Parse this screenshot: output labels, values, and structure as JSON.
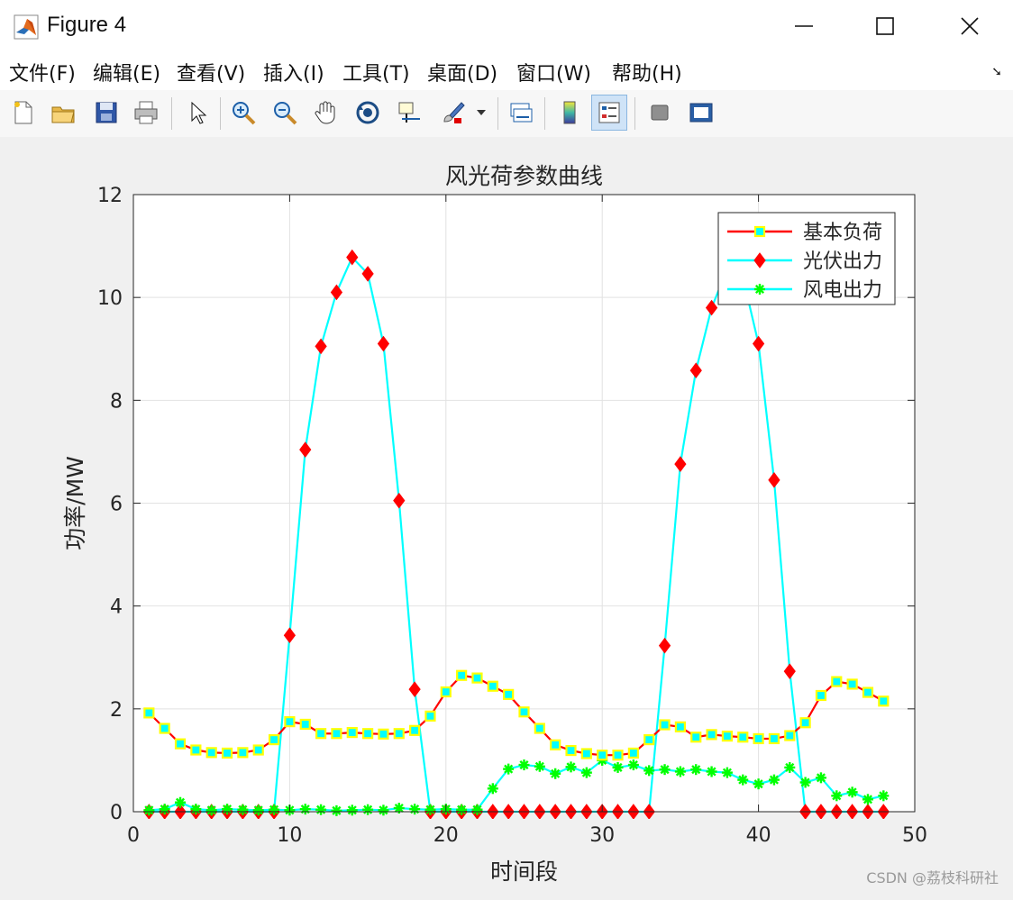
{
  "window": {
    "title": "Figure 4"
  },
  "menu": [
    "文件(F)",
    "编辑(E)",
    "查看(V)",
    "插入(I)",
    "工具(T)",
    "桌面(D)",
    "窗口(W)",
    "帮助(H)"
  ],
  "toolbar": {
    "icons": [
      "new-file-icon",
      "open-folder-icon",
      "save-icon",
      "print-icon",
      "pointer-icon",
      "zoom-in-icon",
      "zoom-out-icon",
      "pan-hand-icon",
      "rotate-3d-icon",
      "data-cursor-icon",
      "brush-icon",
      "link-plot-icon",
      "colorbar-icon",
      "legend-icon",
      "hide-plot-tools-icon",
      "show-plot-tools-icon"
    ],
    "active": "legend-icon"
  },
  "watermark": "CSDN @荔枝科研社",
  "chart_data": {
    "type": "line",
    "title": "风光荷参数曲线",
    "xlabel": "时间段",
    "ylabel": "功率/MW",
    "xlim": [
      0,
      50
    ],
    "ylim": [
      0,
      12
    ],
    "xticks": [
      0,
      10,
      20,
      30,
      40,
      50
    ],
    "yticks": [
      0,
      2,
      4,
      6,
      8,
      10,
      12
    ],
    "grid": true,
    "legend_position": "top-right",
    "x": [
      1,
      2,
      3,
      4,
      5,
      6,
      7,
      8,
      9,
      10,
      11,
      12,
      13,
      14,
      15,
      16,
      17,
      18,
      19,
      20,
      21,
      22,
      23,
      24,
      25,
      26,
      27,
      28,
      29,
      30,
      31,
      32,
      33,
      34,
      35,
      36,
      37,
      38,
      39,
      40,
      41,
      42,
      43,
      44,
      45,
      46,
      47,
      48
    ],
    "series": [
      {
        "name": "基本负荷",
        "line_color": "#ff0000",
        "marker": "square",
        "marker_face": "#00ffff",
        "marker_edge": "#ffff00",
        "values": [
          1.92,
          1.62,
          1.32,
          1.2,
          1.15,
          1.14,
          1.15,
          1.2,
          1.4,
          1.75,
          1.7,
          1.52,
          1.52,
          1.54,
          1.52,
          1.51,
          1.52,
          1.58,
          1.86,
          2.33,
          2.65,
          2.6,
          2.44,
          2.28,
          1.94,
          1.62,
          1.3,
          1.19,
          1.13,
          1.1,
          1.1,
          1.14,
          1.4,
          1.69,
          1.65,
          1.45,
          1.5,
          1.47,
          1.45,
          1.42,
          1.42,
          1.48,
          1.73,
          2.26,
          2.53,
          2.48,
          2.32,
          2.15
        ]
      },
      {
        "name": "光伏出力",
        "line_color": "#00ffff",
        "marker": "diamond",
        "marker_face": "#ff0000",
        "marker_edge": "#ff0000",
        "values": [
          0,
          0,
          0,
          0,
          0,
          0,
          0,
          0,
          0,
          3.43,
          7.04,
          9.05,
          10.1,
          10.78,
          10.46,
          9.1,
          6.05,
          2.38,
          0,
          0,
          0,
          0,
          0,
          0,
          0,
          0,
          0,
          0,
          0,
          0,
          0,
          0,
          0,
          3.23,
          6.76,
          8.58,
          9.8,
          10.55,
          10.4,
          9.1,
          6.45,
          2.73,
          0,
          0,
          0,
          0,
          0,
          0
        ]
      },
      {
        "name": "风电出力",
        "line_color": "#00ffff",
        "marker": "asterisk",
        "marker_face": "#00ff00",
        "marker_edge": "#00ff00",
        "values": [
          0.03,
          0.05,
          0.18,
          0.05,
          0.03,
          0.05,
          0.04,
          0.03,
          0.04,
          0.03,
          0.05,
          0.04,
          0.02,
          0.03,
          0.04,
          0.03,
          0.07,
          0.05,
          0.04,
          0.05,
          0.04,
          0.04,
          0.45,
          0.83,
          0.91,
          0.88,
          0.74,
          0.87,
          0.76,
          1.0,
          0.86,
          0.91,
          0.8,
          0.82,
          0.78,
          0.82,
          0.78,
          0.76,
          0.62,
          0.54,
          0.62,
          0.86,
          0.57,
          0.66,
          0.31,
          0.38,
          0.24,
          0.31
        ]
      }
    ]
  }
}
